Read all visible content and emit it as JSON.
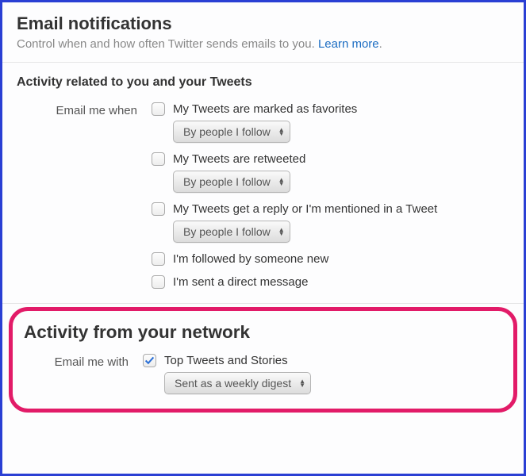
{
  "header": {
    "title": "Email notifications",
    "subtitle": "Control when and how often Twitter sends emails to you. ",
    "learn_more": "Learn more"
  },
  "section1": {
    "title": "Activity related to you and your Tweets",
    "label": "Email me when",
    "options": [
      {
        "label": "My Tweets are marked as favorites",
        "select": "By people I follow"
      },
      {
        "label": "My Tweets are retweeted",
        "select": "By people I follow"
      },
      {
        "label": "My Tweets get a reply or I'm mentioned in a Tweet",
        "select": "By people I follow"
      },
      {
        "label": "I'm followed by someone new"
      },
      {
        "label": "I'm sent a direct message"
      }
    ]
  },
  "section2": {
    "title": "Activity from your network",
    "label": "Email me with",
    "option": {
      "label": "Top Tweets and Stories",
      "select": "Sent as a weekly digest",
      "checked": true
    }
  }
}
